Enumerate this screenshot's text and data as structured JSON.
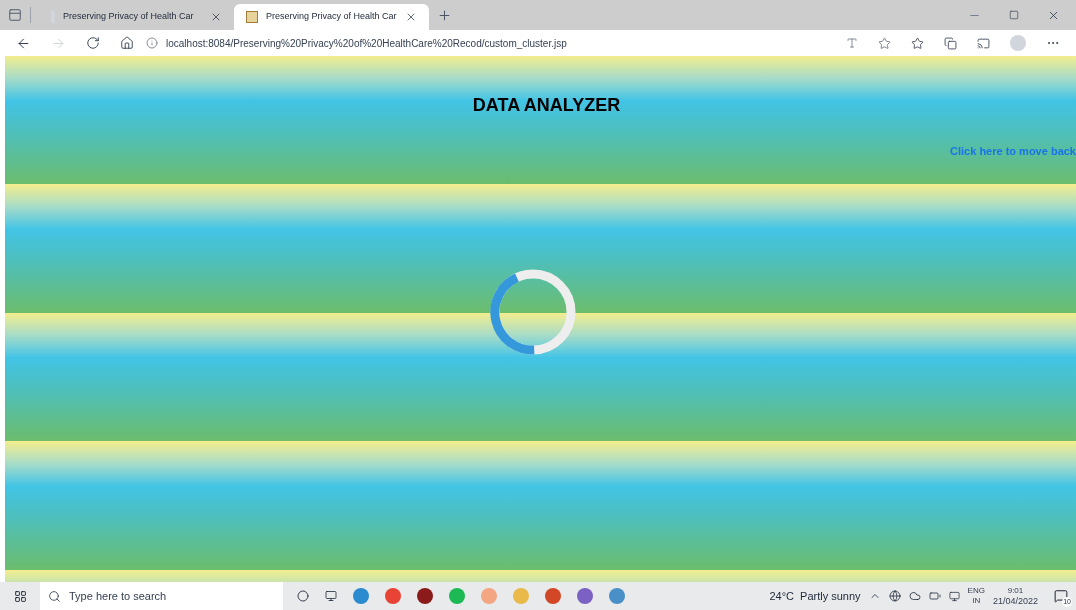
{
  "browser": {
    "tabs": [
      {
        "title": "Preserving Privacy of Health Car",
        "selected": false
      },
      {
        "title": "Preserving Privacy of Health Car",
        "selected": true
      }
    ],
    "address": "localhost:8084/Preserving%20Privacy%20of%20HealthCare%20Recod/custom_cluster.jsp"
  },
  "page": {
    "heading": "DATA ANALYZER",
    "back_link": "Click here to move back"
  },
  "taskbar": {
    "search_placeholder": "Type here to search",
    "weather": "24°C  Partly sunny",
    "language": "ENG",
    "region": "IN",
    "time": "9:01",
    "date": "21/04/2022",
    "notifications": "10"
  }
}
